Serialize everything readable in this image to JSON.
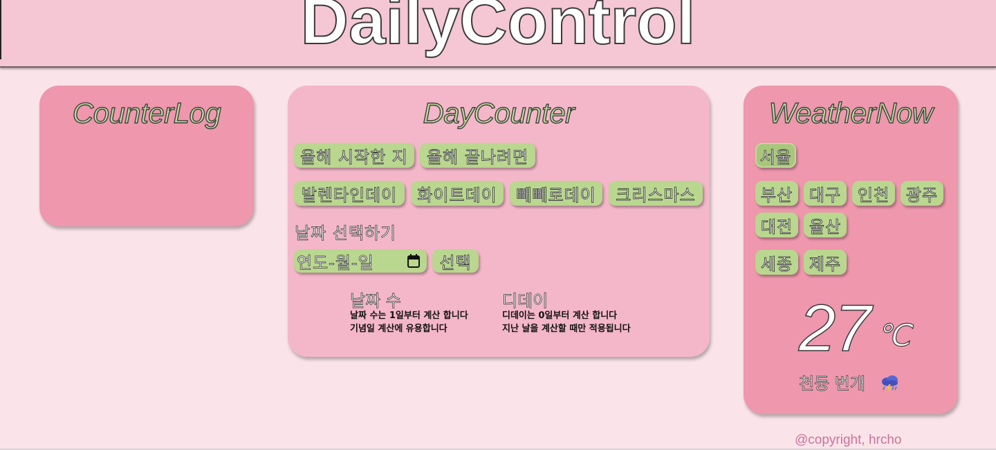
{
  "header": {
    "title": "DailyControl"
  },
  "counter_log": {
    "title": "CounterLog"
  },
  "day_counter": {
    "title": "DayCounter",
    "year_buttons": [
      "올해 시작한 지",
      "올해 끝나려면"
    ],
    "holiday_buttons": [
      "발렌타인데이",
      "화이트데이",
      "빼빼로데이",
      "크리스마스"
    ],
    "date_select_label": "날짜 선택하기",
    "date_input_placeholder": "연도-월-일",
    "select_button": "선택",
    "info": {
      "days_count_title": "날짜 수",
      "days_count_line1": "날짜 수는 1일부터 계산 합니다",
      "days_count_line2": "기념일 계산에 유용합니다",
      "dday_title": "디데이",
      "dday_line1": "디데이는 0일부터 계산 합니다",
      "dday_line2": "지난 날을 계산할 때만 적용됩니다"
    }
  },
  "weather": {
    "title": "WeatherNow",
    "selected_city": "서울",
    "cities": [
      "서울",
      "부산",
      "대구",
      "인천",
      "광주",
      "대전",
      "울산",
      "세종",
      "제주"
    ],
    "temperature": "27",
    "unit": "℃",
    "description": "천둥 번개",
    "icon": "thunderstorm-rain-cloud-icon"
  },
  "footer": {
    "copyright": "@copyright, hrcho"
  },
  "colors": {
    "page_bg": "#fae4ea",
    "header_bg": "#f5c6d3",
    "card_dark": "#ee97ad",
    "card_light": "#f4b7c9",
    "button_green": "#b9d78e",
    "title_green": "#bfd99a"
  }
}
